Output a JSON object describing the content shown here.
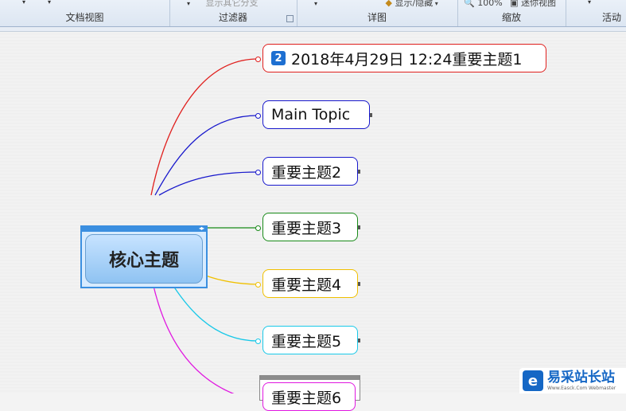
{
  "ribbon": {
    "groups": [
      {
        "label": "文档视图",
        "top_text": ""
      },
      {
        "label": "过滤器",
        "top_text": "显示其它分支"
      },
      {
        "label": "详图",
        "top_text": "显示/隐藏"
      },
      {
        "label": "缩放",
        "top_text": "100%",
        "extra": "迷你视图"
      },
      {
        "label": "活动",
        "top_text": ""
      }
    ]
  },
  "central_topic": {
    "label": "核心主题"
  },
  "topics": [
    {
      "badge": "2",
      "label": "2018年4月29日 12:24重要主题1",
      "color": "#e0201e"
    },
    {
      "label": "Main Topic",
      "color": "#1818cc"
    },
    {
      "label": "重要主题2",
      "color": "#1818cc"
    },
    {
      "label": "重要主题3",
      "color": "#188a18"
    },
    {
      "label": "重要主题4",
      "color": "#f0c000"
    },
    {
      "label": "重要主题5",
      "color": "#18c8e8"
    },
    {
      "label": "重要主题6",
      "color": "#e018e0"
    }
  ],
  "watermark": {
    "logo": "e",
    "main": "易采站长站",
    "sub": "Www.Easck.Com Webmaster"
  }
}
